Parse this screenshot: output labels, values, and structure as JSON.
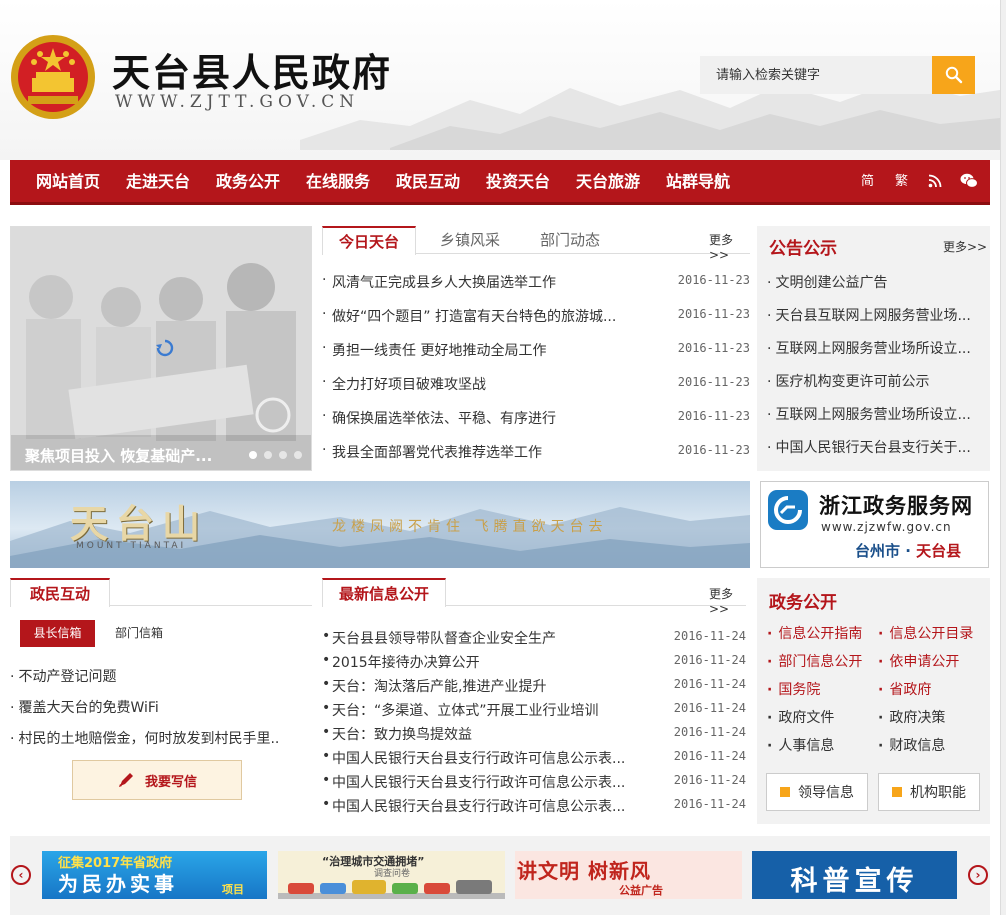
{
  "header": {
    "title": "天台县人民政府",
    "url": "WWW.ZJTT.GOV.CN",
    "search_placeholder": "请输入检索关键字"
  },
  "nav": {
    "items": [
      "网站首页",
      "走进天台",
      "政务公开",
      "在线服务",
      "政民互动",
      "投资天台",
      "天台旅游",
      "站群导航"
    ],
    "tools": [
      "简",
      "繁"
    ]
  },
  "slider": {
    "caption": "聚焦项目投入 恢复基础产..."
  },
  "today": {
    "tabs": [
      "今日天台",
      "乡镇风采",
      "部门动态"
    ],
    "more": "更多>>",
    "news": [
      {
        "title": "风清气正完成县乡人大换届选举工作",
        "date": "2016-11-23"
      },
      {
        "title": "做好“四个题目” 打造富有天台特色的旅游城...",
        "date": "2016-11-23"
      },
      {
        "title": "勇担一线责任 更好地推动全局工作",
        "date": "2016-11-23"
      },
      {
        "title": "全力打好项目破难攻坚战",
        "date": "2016-11-23"
      },
      {
        "title": "确保换届选举依法、平稳、有序进行",
        "date": "2016-11-23"
      },
      {
        "title": "我县全面部署党代表推荐选举工作",
        "date": "2016-11-23"
      }
    ]
  },
  "notice": {
    "title": "公告公示",
    "more": "更多>>",
    "items": [
      "文明创建公益广告",
      "天台县互联网上网服务营业场...",
      "互联网上网服务营业场所设立...",
      "医疗机构变更许可前公示",
      "互联网上网服务营业场所设立...",
      "中国人民银行天台县支行关于..."
    ]
  },
  "banner": {
    "title": "天台山",
    "subtitle": "MOUNT TIANTAI",
    "slogan": "龙楼凤阙不肯住  飞腾直欲天台去"
  },
  "zjzwfw": {
    "title": "浙江政务服务网",
    "url": "www.zjzwfw.gov.cn",
    "city": "台州市",
    "county": "天台县"
  },
  "interaction": {
    "title": "政民互动",
    "tabs": [
      "县长信箱",
      "部门信箱"
    ],
    "items": [
      "不动产登记问题",
      "覆盖大天台的免费WiFi",
      "村民的土地赔偿金，何时放发到村民手里.."
    ],
    "write_button": "我要写信"
  },
  "disclosure": {
    "title": "最新信息公开",
    "more": "更多>>",
    "news": [
      {
        "title": "天台县县领导带队督查企业安全生产",
        "date": "2016-11-24"
      },
      {
        "title": "2015年接待办决算公开",
        "date": "2016-11-24"
      },
      {
        "title": "天台：淘汰落后产能,推进产业提升",
        "date": "2016-11-24"
      },
      {
        "title": "天台：“多渠道、立体式”开展工业行业培训",
        "date": "2016-11-24"
      },
      {
        "title": "天台：致力换鸟提效益",
        "date": "2016-11-24"
      },
      {
        "title": "中国人民银行天台县支行行政许可信息公示表...",
        "date": "2016-11-24"
      },
      {
        "title": "中国人民银行天台县支行行政许可信息公示表...",
        "date": "2016-11-24"
      },
      {
        "title": "中国人民银行天台县支行行政许可信息公示表...",
        "date": "2016-11-24"
      }
    ]
  },
  "gov": {
    "title": "政务公开",
    "links": [
      {
        "label": "信息公开指南",
        "style": "red"
      },
      {
        "label": "信息公开目录",
        "style": "red"
      },
      {
        "label": "部门信息公开",
        "style": "red"
      },
      {
        "label": "依申请公开",
        "style": "red"
      },
      {
        "label": "国务院",
        "style": "red"
      },
      {
        "label": "省政府",
        "style": "red"
      },
      {
        "label": "政府文件",
        "style": "dark"
      },
      {
        "label": "政府决策",
        "style": "dark"
      },
      {
        "label": "人事信息",
        "style": "dark"
      },
      {
        "label": "财政信息",
        "style": "dark"
      }
    ],
    "buttons": [
      "领导信息",
      "机构职能"
    ]
  },
  "ads": [
    {
      "line1": "征集2017年省政府",
      "line2": "为民办实事",
      "line3": "项目"
    },
    {
      "line1": "“治理城市交通拥堵”",
      "line2": "调查问卷"
    },
    {
      "line1": "讲文明 树新风",
      "line2": "公益广告"
    },
    {
      "line1": "科普宣传"
    }
  ],
  "colors": {
    "brand_red": "#b4161b",
    "accent_orange": "#f7a51a",
    "blue": "#1a7cc4"
  }
}
